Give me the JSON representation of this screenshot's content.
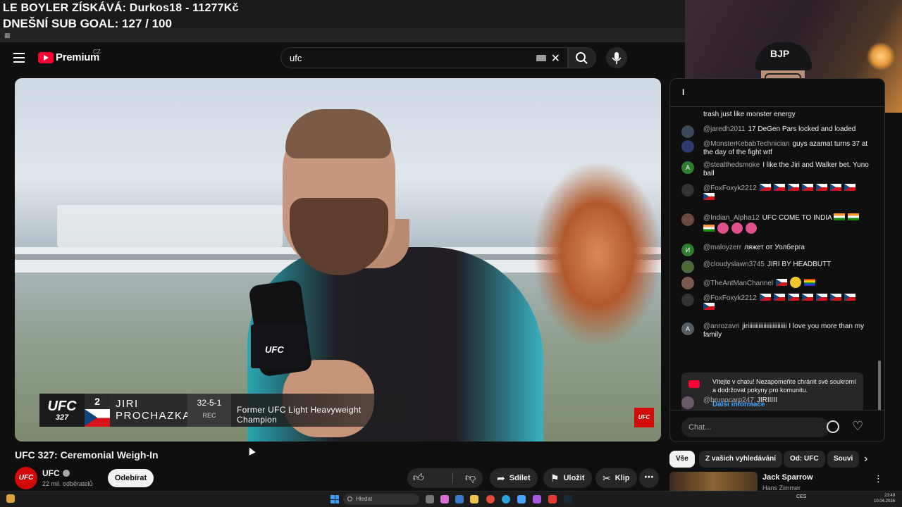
{
  "overlay": {
    "line1": "LE BOYLER ZÍSKÁVÁ: Durkos18 - 11277Kč",
    "line2": "DNEŠNÍ SUB GOAL: 127 / 100"
  },
  "webcam": {
    "cap_text": "BJP"
  },
  "header": {
    "logo_text": "Premium",
    "country": "CZ",
    "search_value": "ufc"
  },
  "video": {
    "lower_third": {
      "org": "UFC",
      "event_number": "327",
      "rank": "2",
      "first_name": "JIRI",
      "last_name": "PROCHAZKA",
      "record": "32-5-1",
      "record_label": "REC",
      "title": "Former UFC Light Heavyweight Champion"
    },
    "mic_label": "UFC",
    "corner_logo": "UFC"
  },
  "meta": {
    "title": "UFC 327: Ceremonial Weigh-In",
    "channel": "UFC",
    "subscribers": "22 mil. odběratelů",
    "subscribe_label": "Odebírat",
    "share_label": "Sdílet",
    "save_label": "Uložit",
    "clip_label": "Klip"
  },
  "chat": {
    "header_mark": "I",
    "messages": [
      {
        "author": "",
        "text": "trash just like monster energy",
        "avatar": ""
      },
      {
        "author": "@jaredh2011",
        "text": "17 DeGen Pars locked and loaded",
        "avatar": ""
      },
      {
        "author": "@MonsterKebabTechnician",
        "text": "guys azamat turns 37 at the day of the fight wtf",
        "avatar": ""
      },
      {
        "author": "@stealthedsmoke",
        "text": "I like the Jiri and Walker bet. Yuno ball",
        "avatar": "A"
      },
      {
        "author": "@FoxFoxyk2212",
        "text": "",
        "avatar": ""
      },
      {
        "author": "@Indian_Alpha12",
        "text": "UFC COME TO INDIA",
        "avatar": ""
      },
      {
        "author": "@maloyzerr",
        "text": "ляжет от Уолберга",
        "avatar": "И"
      },
      {
        "author": "@cloudyslawn3745",
        "text": "JIRI BY HEADBUTT",
        "avatar": ""
      },
      {
        "author": "@TheAntManChannel",
        "text": "",
        "avatar": ""
      },
      {
        "author": "@FoxFoxyk2212",
        "text": "",
        "avatar": ""
      },
      {
        "author": "@anrozavri",
        "text": "jiriiiiiiiiiiiiiiiiiiiiiiiii I love you more than my family",
        "avatar": "A"
      },
      {
        "author": "@brunocarp247",
        "text": "JIRIIIII",
        "avatar": ""
      }
    ],
    "notice_text": "Vítejte v chatu! Nezapomeňte chránit své soukromí a dodržovat pokyny pro komunitu.",
    "notice_link": "Další informace",
    "input_placeholder": "Chat..."
  },
  "chips": [
    "Vše",
    "Z vašich vyhledávání",
    "Od: UFC",
    "Souvi"
  ],
  "related": {
    "title": "Jack Sparrow",
    "author": "Hans Zimmer"
  },
  "taskbar": {
    "search_placeholder": "Hledat",
    "tray": "CES",
    "time": "23:49",
    "date": "10.04.2026"
  },
  "colors": {
    "brand_red": "#ff0033",
    "ufc_red": "#d20a0a",
    "link_blue": "#3ea6ff"
  }
}
